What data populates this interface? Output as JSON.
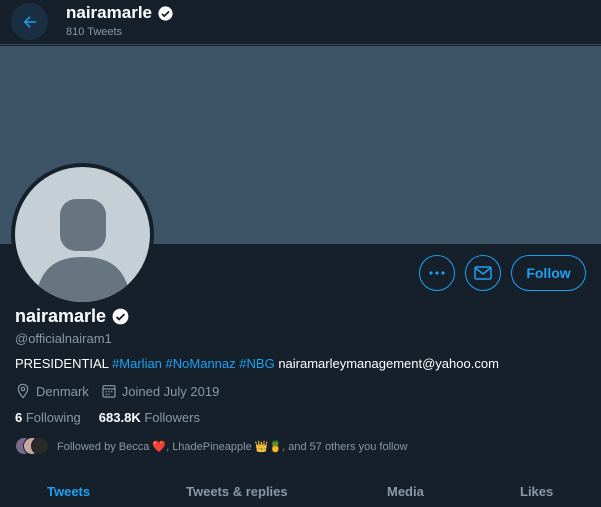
{
  "header": {
    "name": "nairamarle",
    "tweet_count": "810 Tweets"
  },
  "profile": {
    "name": "nairamarle",
    "handle": "@officialnairam1",
    "bio_prefix": "PRESIDENTIAL",
    "hashtags": [
      "#Marlian",
      "#NoMannaz",
      "#NBG"
    ],
    "bio_email": "nairamarleymanagement@yahoo.com",
    "location": "Denmark",
    "joined": "Joined July 2019",
    "following_count": "6",
    "following_label": "Following",
    "followers_count": "683.8K",
    "followers_label": "Followers",
    "followed_by_text": "Followed by Becca ❤️, LhadePineapple 👑🍍, and 57 others you follow"
  },
  "actions": {
    "follow_label": "Follow"
  },
  "tabs": [
    {
      "label": "Tweets"
    },
    {
      "label": "Tweets & replies"
    },
    {
      "label": "Media"
    },
    {
      "label": "Likes"
    }
  ],
  "colors": {
    "accent": "#1da1f2",
    "background": "#15202b",
    "banner": "#3d5466",
    "secondary_text": "#8899a6"
  },
  "icons": {
    "back": "arrow-left-icon",
    "verified": "verified-badge-icon",
    "more": "more-dots-icon",
    "message": "envelope-icon",
    "location": "location-pin-icon",
    "calendar": "calendar-icon"
  }
}
